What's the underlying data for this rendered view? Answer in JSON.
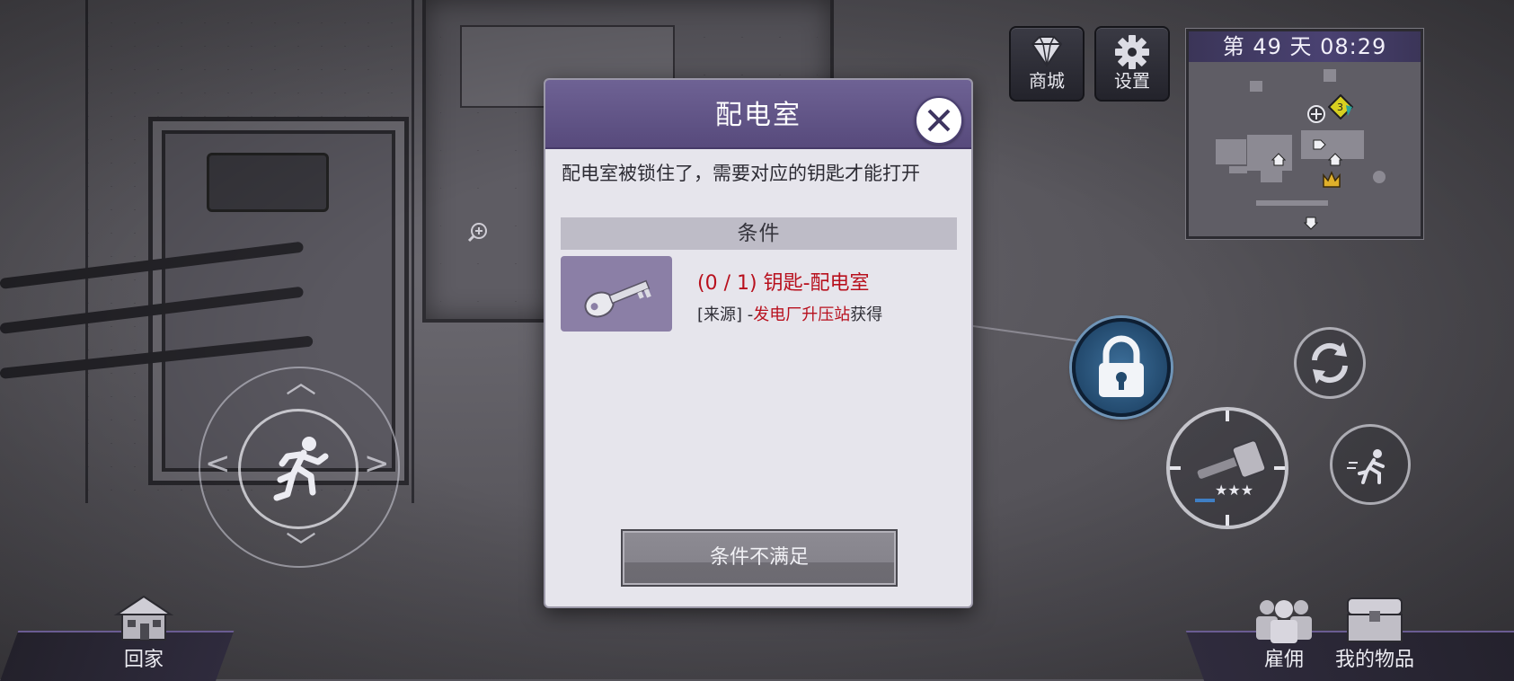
{
  "hud": {
    "shop_label": "商城",
    "settings_label": "设置",
    "day_time": "第 49 天  08:29",
    "home_label": "回家",
    "hire_label": "雇佣",
    "items_label": "我的物品"
  },
  "dialog": {
    "title": "配电室",
    "description": "配电室被锁住了，需要对应的钥匙才能打开",
    "conditions_header": "条件",
    "requirement": {
      "progress": "(0 / 1)",
      "item_name": "钥匙-配电室",
      "source_prefix": "[来源] -",
      "source_place": "发电厂升压站",
      "source_suffix": "获得"
    },
    "action_label": "条件不满足"
  },
  "icons": {
    "shop": "diamond-icon",
    "settings": "gear-icon",
    "close": "close-icon",
    "key": "key-icon",
    "lock": "lock-icon",
    "refresh": "refresh-icon",
    "attack": "hammer-icon",
    "sprint": "sprint-icon",
    "home": "house-icon",
    "hire": "people-icon",
    "items": "chest-icon"
  },
  "colors": {
    "dialog_header": "#5f5287",
    "requirement_red": "#b8101d",
    "lock_blue": "#2c5a82"
  }
}
